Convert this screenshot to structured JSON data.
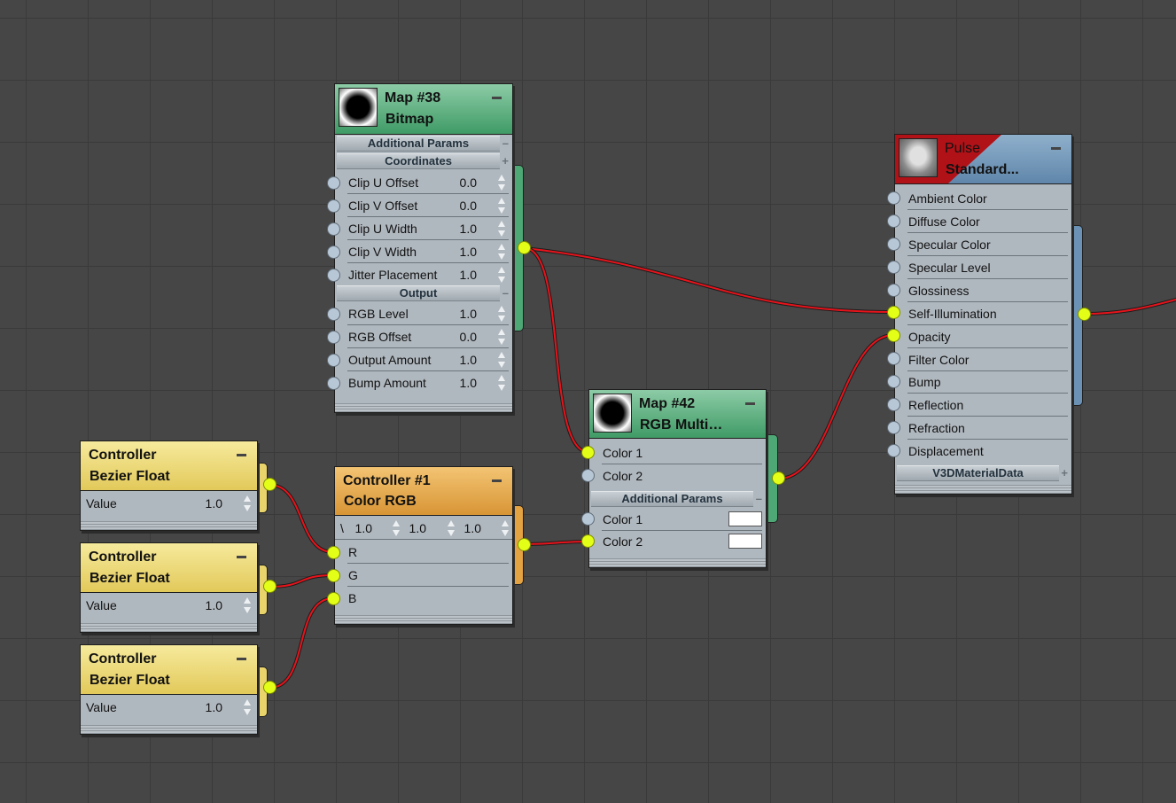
{
  "bitmap_node": {
    "title": "Map #38",
    "subtitle": "Bitmap",
    "sections": [
      "Additional Params",
      "Coordinates",
      "Output"
    ],
    "section_buttons": [
      "–",
      "+",
      "–"
    ],
    "coordinates": [
      {
        "label": "Clip U Offset",
        "value": "0.0"
      },
      {
        "label": "Clip V Offset",
        "value": "0.0"
      },
      {
        "label": "Clip U Width",
        "value": "1.0"
      },
      {
        "label": "Clip V Width",
        "value": "1.0"
      },
      {
        "label": "Jitter Placement",
        "value": "1.0"
      }
    ],
    "output": [
      {
        "label": "RGB Level",
        "value": "1.0"
      },
      {
        "label": "RGB Offset",
        "value": "0.0"
      },
      {
        "label": "Output Amount",
        "value": "1.0"
      },
      {
        "label": "Bump Amount",
        "value": "1.0"
      }
    ]
  },
  "rgbmult_node": {
    "title": "Map #42",
    "subtitle": "RGB Multi…",
    "inputs": [
      "Color 1",
      "Color 2"
    ],
    "section": "Additional Params",
    "section_button": "–",
    "params": [
      {
        "label": "Color 1",
        "color": "#ffffff"
      },
      {
        "label": "Color 2",
        "color": "#ffffff"
      }
    ]
  },
  "controllers": [
    {
      "title": "Controller",
      "subtitle": "Bezier Float",
      "label": "Value",
      "value": "1.0"
    },
    {
      "title": "Controller",
      "subtitle": "Bezier Float",
      "label": "Value",
      "value": "1.0"
    },
    {
      "title": "Controller",
      "subtitle": "Bezier Float",
      "label": "Value",
      "value": "1.0"
    }
  ],
  "color_node": {
    "title": "Controller #1",
    "subtitle": "Color RGB",
    "prefix": "\\",
    "values": [
      "1.0",
      "1.0",
      "1.0"
    ],
    "inputs": [
      "R",
      "G",
      "B"
    ]
  },
  "material_node": {
    "title": "Pulse",
    "subtitle": "Standard...",
    "inputs": [
      "Ambient Color",
      "Diffuse Color",
      "Specular Color",
      "Specular Level",
      "Glossiness",
      "Self-Illumination",
      "Opacity",
      "Filter Color",
      "Bump",
      "Reflection",
      "Refraction",
      "Displacement"
    ],
    "connected": [
      "Self-Illumination",
      "Opacity"
    ],
    "section": "V3DMaterialData",
    "section_button": "+"
  },
  "colors": {
    "wire": "#e8131b",
    "socket_connected": "#e4ff17",
    "socket_free": "#b8c7d6",
    "map_header": "#4ea875",
    "controller_header": "#e9d46c",
    "color_header": "#e4a343",
    "material_header": "#6b92b4",
    "material_accent": "#b01218"
  }
}
